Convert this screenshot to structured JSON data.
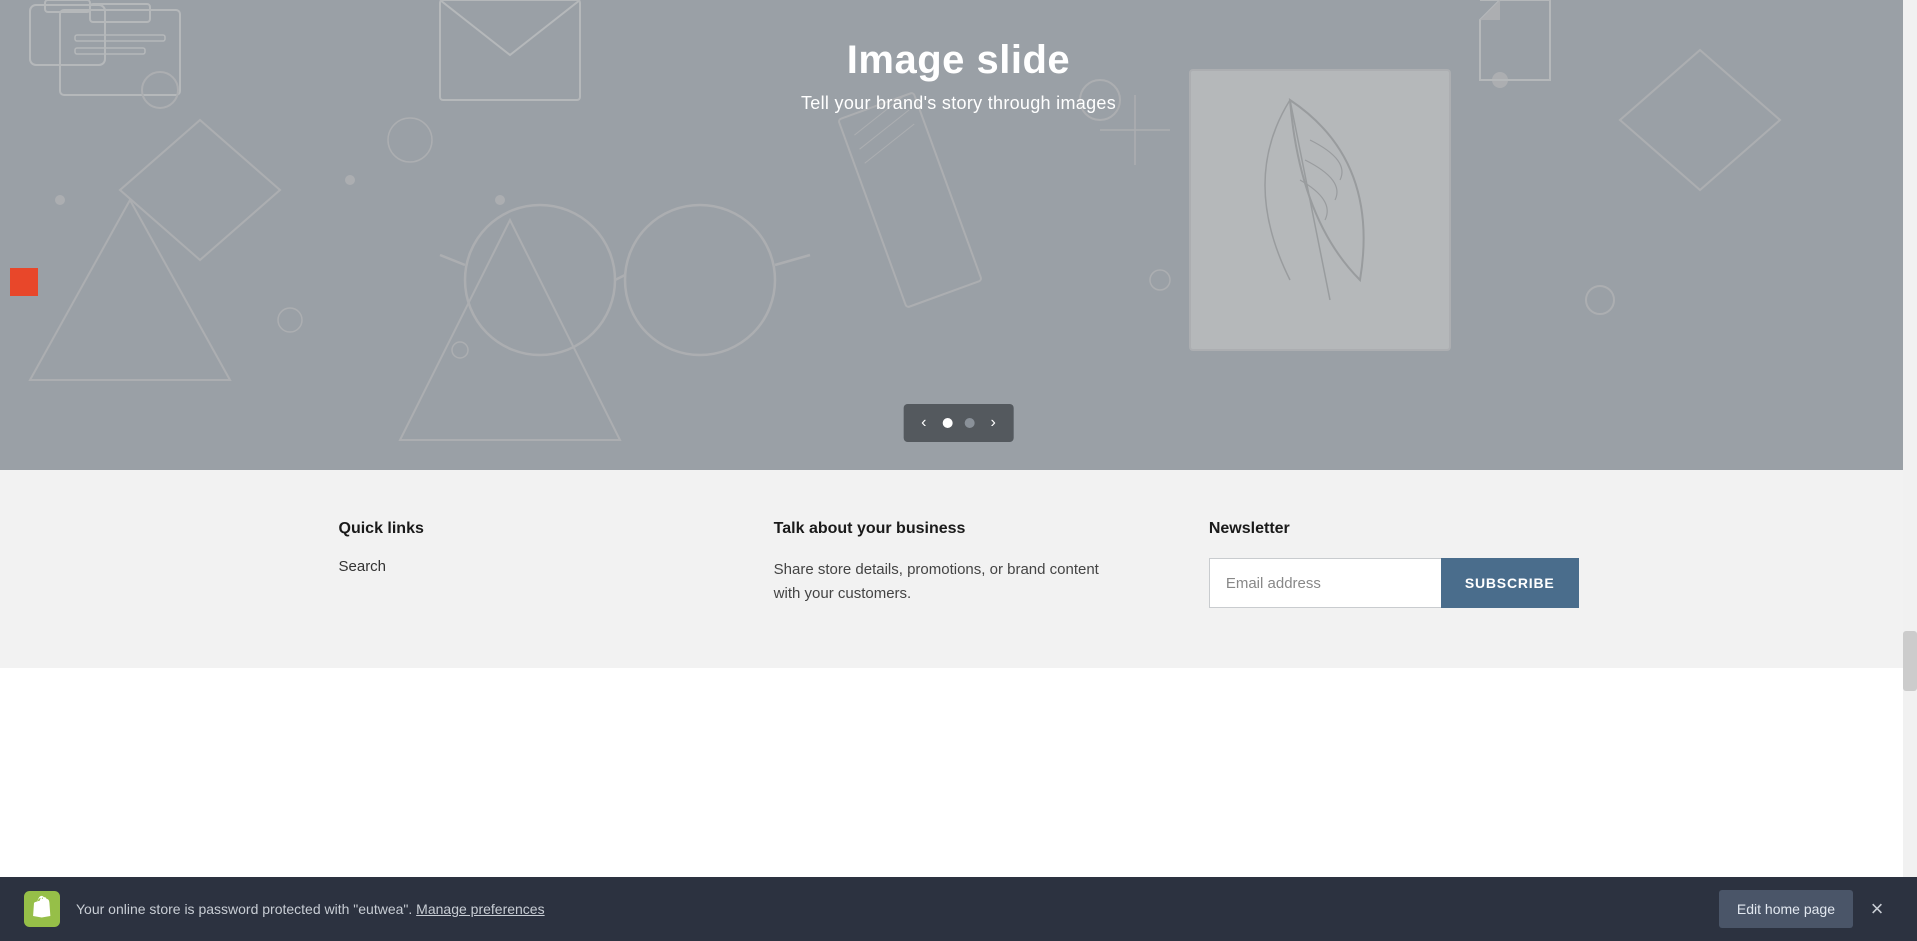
{
  "hero": {
    "title": "Image slide",
    "subtitle": "Tell your brand's story through images",
    "slide_prev_label": "‹",
    "slide_next_label": "›",
    "slides": [
      {
        "id": 1,
        "active": true
      },
      {
        "id": 2,
        "active": false
      }
    ]
  },
  "footer": {
    "quick_links_heading": "Quick links",
    "quick_links": [
      {
        "label": "Search",
        "href": "#"
      }
    ],
    "business_heading": "Talk about your business",
    "business_text": "Share store details, promotions, or brand content with your customers.",
    "newsletter_heading": "Newsletter",
    "email_placeholder": "Email address",
    "subscribe_label": "SUBSCRIBE"
  },
  "notification_bar": {
    "text": "Your online store is password protected with \"eutwea\".",
    "link_text": "Manage preferences",
    "edit_label": "Edit home page",
    "close_label": "×"
  }
}
